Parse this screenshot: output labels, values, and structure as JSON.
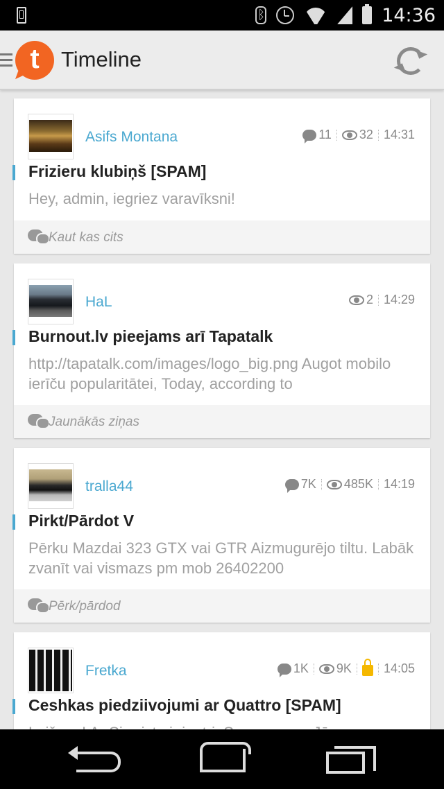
{
  "status_bar": {
    "time": "14:36",
    "icons": [
      "phone-icon",
      "bluetooth-icon",
      "alarm-icon",
      "wifi-icon",
      "signal-icon",
      "battery-icon"
    ]
  },
  "app_bar": {
    "logo_letter": "t",
    "title": "Timeline",
    "icons": [
      "menu-icon",
      "refresh-icon"
    ]
  },
  "accent_color": "#4aa8d0",
  "topics": [
    {
      "username": "Asifs Montana",
      "comments": "11",
      "views": "32",
      "time": "14:31",
      "locked": false,
      "title": "Frizieru klubiņš [SPAM]",
      "excerpt": "Hey, admin, iegriez varavīksni!",
      "forum": "Kaut kas cits"
    },
    {
      "username": "HaL",
      "comments": "",
      "views": "2",
      "time": "14:29",
      "locked": false,
      "title": "Burnout.lv pieejams arī Tapatalk",
      "excerpt": "http://tapatalk.com/images/logo_big.png Augot mobilo ierīču popularitātei, Today, according to",
      "forum": "Jaunākās ziņas"
    },
    {
      "username": "tralla44",
      "comments": "7K",
      "views": "485K",
      "time": "14:19",
      "locked": false,
      "title": "Pirkt/Pārdot V",
      "excerpt": "Pērku Mazdai 323 GTX vai GTR Aizmugurējo tiltu. Labāk zvanīt vai vismazs pm mob 26402200",
      "forum": "Pērk/pārdod"
    },
    {
      "username": "Fretka",
      "comments": "1K",
      "views": "9K",
      "time": "14:05",
      "locked": true,
      "title": "Ceshkas piedziivojumi ar Quattro [SPAM]",
      "excerpt": "Laižam ! Ar Sierristu ir jautri. Sorry, :naac: Jā",
      "forum": ""
    }
  ],
  "nav_bar": {
    "icons": [
      "back-icon",
      "home-icon",
      "recent-apps-icon"
    ]
  }
}
